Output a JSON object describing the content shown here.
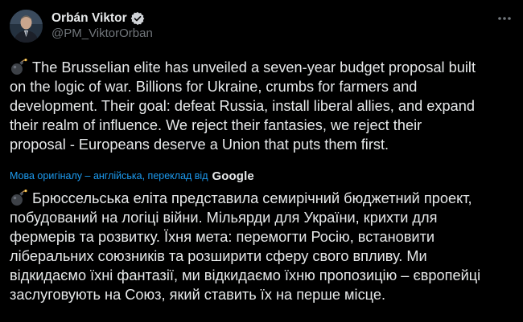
{
  "author": {
    "display_name": "Orbán Viktor",
    "handle": "@PM_ViktorOrban",
    "verified": true
  },
  "icons": {
    "verified": "verified-badge-icon",
    "more": "more-options-icon",
    "emoji": "bomb-emoji-icon",
    "translator": "google-logo"
  },
  "colors": {
    "background": "#000000",
    "text": "#e7e9ea",
    "muted": "#71767b",
    "link": "#1d9bf0"
  },
  "tweet": {
    "original_lines": [
      "The Brusselian elite has unveiled a seven-year budget proposal built",
      "on the logic of war. Billions for Ukraine, crumbs for farmers and",
      "development. Their goal: defeat Russia, install liberal allies, and expand",
      "their realm of influence. We reject their fantasies, we reject their",
      "proposal - Europeans deserve a Union that puts them first."
    ],
    "translation_note": "Мова оригіналу – англійська, переклад від",
    "translator_name": "Google",
    "translated_lines": [
      "Брюссельська еліта представила семирічний бюджетний проект,",
      "побудований на логіці війни. Мільярди для України, крихти для",
      "фермерів та розвитку. Їхня мета: перемогти Росію, встановити",
      "ліберальних союзників та розширити сферу свого впливу. Ми",
      "відкидаємо їхні фантазії, ми відкидаємо їхню пропозицію – європейці",
      "заслуговують на Союз, який ставить їх на перше місце."
    ]
  }
}
